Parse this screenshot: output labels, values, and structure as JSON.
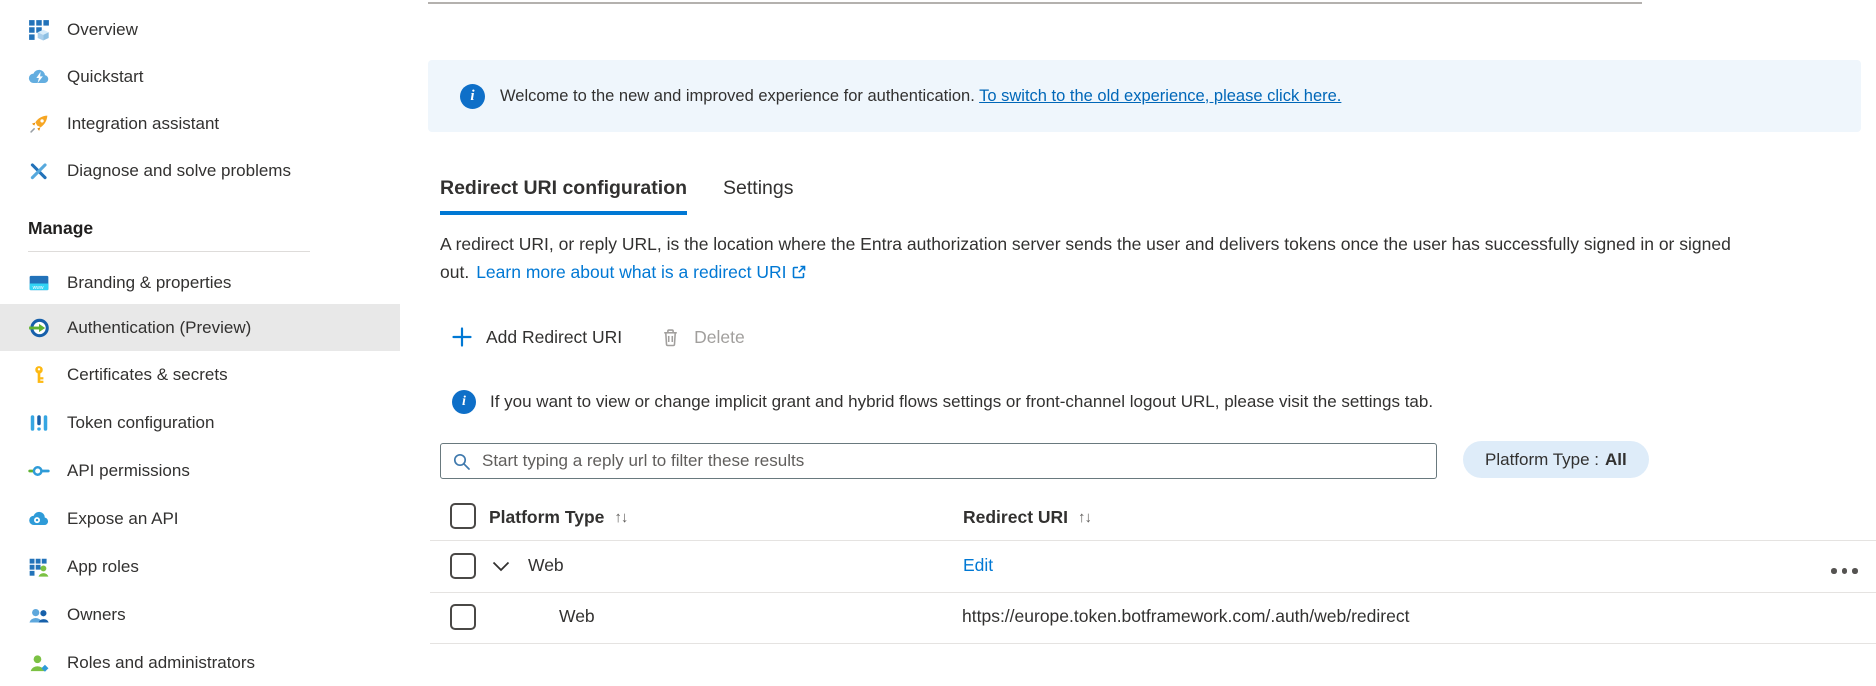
{
  "sidebar": {
    "items": [
      {
        "label": "Overview",
        "icon": "overview-grid-cube"
      },
      {
        "label": "Quickstart",
        "icon": "cloud-lightning"
      },
      {
        "label": "Integration assistant",
        "icon": "rocket"
      },
      {
        "label": "Diagnose and solve problems",
        "icon": "crossed-tools"
      }
    ],
    "section_header": "Manage",
    "manage_items": [
      {
        "label": "Branding & properties",
        "icon": "browser-window"
      },
      {
        "label": "Authentication (Preview)",
        "icon": "sign-in-arrow-circle",
        "selected": true
      },
      {
        "label": "Certificates & secrets",
        "icon": "key"
      },
      {
        "label": "Token configuration",
        "icon": "sliders-bars"
      },
      {
        "label": "API permissions",
        "icon": "key-link"
      },
      {
        "label": "Expose an API",
        "icon": "cloud-gear"
      },
      {
        "label": "App roles",
        "icon": "grid-person"
      },
      {
        "label": "Owners",
        "icon": "two-people"
      },
      {
        "label": "Roles and administrators",
        "icon": "person-diamond"
      }
    ]
  },
  "banner": {
    "message": "Welcome to the new and improved experience for authentication.",
    "link_text": "To switch to the old experience, please click here."
  },
  "tabs": {
    "redirect": "Redirect URI configuration",
    "settings": "Settings"
  },
  "description": {
    "text": "A redirect URI, or reply URL, is the location where the Entra authorization server sends the user and delivers tokens once the user has successfully signed in or signed out.",
    "link_text": "Learn more about what is a redirect URI"
  },
  "toolbar": {
    "add_button": "Add Redirect URI",
    "delete_button": "Delete"
  },
  "note": "If you want to view or change implicit grant and hybrid flows settings or front-channel logout URL, please visit the settings tab.",
  "filters": {
    "search_placeholder": "Start typing a reply url to filter these results",
    "platform_type_label": "Platform Type :",
    "platform_type_value": "All"
  },
  "table": {
    "headers": {
      "platform_type": "Platform Type",
      "redirect_uri": "Redirect URI"
    },
    "sort_glyph": "↑↓",
    "rows": [
      {
        "platform": "Web",
        "action": "Edit"
      },
      {
        "platform": "Web",
        "redirect_uri": "https://europe.token.botframework.com/.auth/web/redirect"
      }
    ]
  },
  "icons": {
    "info": "filled-blue-circle-i",
    "search": "magnifier",
    "add": "plus",
    "delete": "trash-outline",
    "external_link": "box-with-arrow",
    "expand": "chevron-down",
    "more": "three-dots"
  },
  "colors": {
    "accent": "#0078d4",
    "banner_bg": "#eff6fc",
    "pill_bg": "#deecf9",
    "selected_bg": "#e8e8e8",
    "text": "#323130",
    "muted": "#605e5c",
    "disabled": "#a19f9d",
    "divider": "#e5e3e1"
  }
}
